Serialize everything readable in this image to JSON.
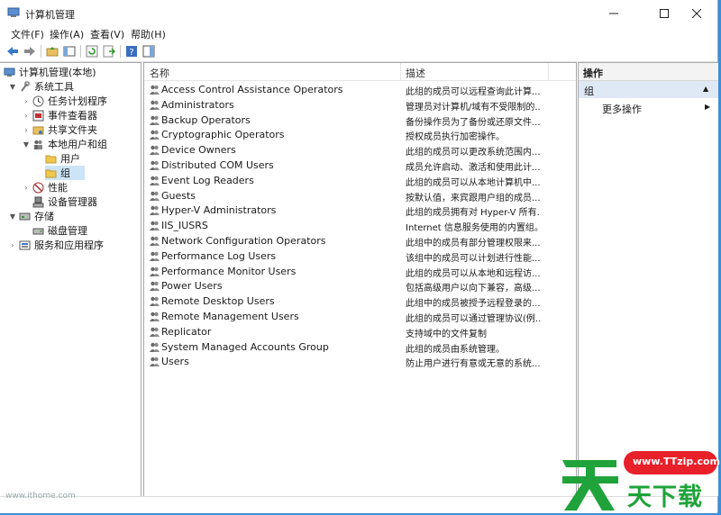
{
  "window": {
    "title": "计算机管理",
    "min": "—",
    "max": "☐",
    "close": "✕"
  },
  "menu": [
    {
      "label": "文件(F)"
    },
    {
      "label": "操作(A)"
    },
    {
      "label": "查看(V)"
    },
    {
      "label": "帮助(H)"
    }
  ],
  "toolbar": {
    "icons": [
      "back-arrow-icon",
      "forward-arrow-icon",
      "up-folder-icon",
      "show-hide-tree-icon",
      "refresh-icon",
      "export-list-icon",
      "help-icon",
      "properties-pane-icon"
    ]
  },
  "tree": [
    {
      "label": "计算机管理(本地)",
      "arrow": "",
      "icon": "computer-management-icon"
    },
    {
      "label": "系统工具",
      "arrow": "▼",
      "icon": "tools-icon"
    },
    {
      "label": "任务计划程序",
      "arrow": "›",
      "icon": "task-scheduler-icon"
    },
    {
      "label": "事件查看器",
      "arrow": "›",
      "icon": "event-viewer-icon"
    },
    {
      "label": "共享文件夹",
      "arrow": "›",
      "icon": "shared-folder-icon"
    },
    {
      "label": "本地用户和组",
      "arrow": "▼",
      "icon": "users-groups-icon"
    },
    {
      "label": "用户",
      "arrow": "",
      "icon": "folder-icon"
    },
    {
      "label": "组",
      "arrow": "",
      "icon": "folder-icon"
    },
    {
      "label": "性能",
      "arrow": "›",
      "icon": "performance-icon"
    },
    {
      "label": "设备管理器",
      "arrow": "",
      "icon": "device-manager-icon"
    },
    {
      "label": "存储",
      "arrow": "▼",
      "icon": "storage-icon"
    },
    {
      "label": "磁盘管理",
      "arrow": "",
      "icon": "disk-management-icon"
    },
    {
      "label": "服务和应用程序",
      "arrow": "›",
      "icon": "services-apps-icon"
    }
  ],
  "list": {
    "col_name": "名称",
    "col_desc": "描述",
    "rows": [
      {
        "name": "Access Control Assistance Operators",
        "desc": "此组的成员可以远程查询此计算..."
      },
      {
        "name": "Administrators",
        "desc": "管理员对计算机/域有不受限制的..."
      },
      {
        "name": "Backup Operators",
        "desc": "备份操作员为了备份或还原文件..."
      },
      {
        "name": "Cryptographic Operators",
        "desc": "授权成员执行加密操作。"
      },
      {
        "name": "Device Owners",
        "desc": "此组的成员可以更改系统范围内..."
      },
      {
        "name": "Distributed COM Users",
        "desc": "成员允许启动、激活和使用此计..."
      },
      {
        "name": "Event Log Readers",
        "desc": "此组的成员可以从本地计算机中..."
      },
      {
        "name": "Guests",
        "desc": "按默认值，来宾跟用户组的成员..."
      },
      {
        "name": "Hyper-V Administrators",
        "desc": "此组的成员拥有对 Hyper-V 所有..."
      },
      {
        "name": "IIS_IUSRS",
        "desc": "Internet 信息服务使用的内置组。"
      },
      {
        "name": "Network Configuration Operators",
        "desc": "此组中的成员有部分管理权限来..."
      },
      {
        "name": "Performance Log Users",
        "desc": "该组中的成员可以计划进行性能..."
      },
      {
        "name": "Performance Monitor Users",
        "desc": "此组的成员可以从本地和远程访..."
      },
      {
        "name": "Power Users",
        "desc": "包括高级用户以向下兼容，高级..."
      },
      {
        "name": "Remote Desktop Users",
        "desc": "此组中的成员被授予远程登录的..."
      },
      {
        "name": "Remote Management Users",
        "desc": "此组的成员可以通过管理协议(例..."
      },
      {
        "name": "Replicator",
        "desc": "支持域中的文件复制"
      },
      {
        "name": "System Managed Accounts Group",
        "desc": "此组的成员由系统管理。"
      },
      {
        "name": "Users",
        "desc": "防止用户进行有意或无意的系统..."
      }
    ]
  },
  "actions": {
    "header": "操作",
    "group": "组",
    "group_arrow": "▲",
    "more": "更多操作",
    "more_arrow": "▶"
  },
  "watermark": {
    "small": "www.ithome.com",
    "badge": "www.TTzip.com",
    "brand": "天下载",
    "brand_big": "天",
    "brand_rest": "天下载"
  },
  "colors": {
    "accent_blue": "#0078d7",
    "selection": "#cce4f7",
    "logo_green": "#1fa33a",
    "logo_red": "#e8202a"
  }
}
